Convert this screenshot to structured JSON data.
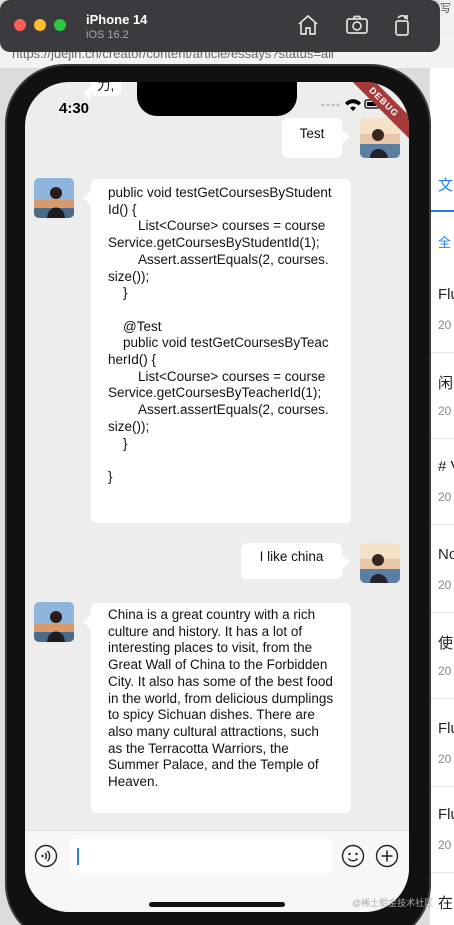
{
  "simulator": {
    "device": "iPhone 14",
    "os": "iOS 16.2",
    "tools": [
      "home-icon",
      "screenshot-icon",
      "rotate-icon"
    ]
  },
  "browser": {
    "url": "https://juejin.cn/creator/content/article/essays?status=all",
    "corner_text": "写",
    "right_items": [
      "文",
      "全",
      "Flu",
      "20",
      "闲",
      "20",
      "# V",
      "20",
      "No",
      "20",
      "使",
      "20",
      "Flu",
      "20",
      "Flu",
      "20",
      "在"
    ],
    "accent": "#1e80ff"
  },
  "status_bar": {
    "time": "4:30",
    "debug_label": "DEBUG"
  },
  "chat": {
    "top_fragment": "力,",
    "messages": [
      {
        "side": "right",
        "text": "Test"
      },
      {
        "side": "left",
        "text": "public void testGetCoursesByStudentId() {\n        List<Course> courses = courseService.getCoursesByStudentId(1);\n        Assert.assertEquals(2, courses.size());\n    }\n\n    @Test\n    public void testGetCoursesByTeacherId() {\n        List<Course> courses = courseService.getCoursesByTeacherId(1);\n        Assert.assertEquals(2, courses.size());\n    }\n\n}"
      },
      {
        "side": "right",
        "text": "I like china"
      },
      {
        "side": "left",
        "text": "China is a great country with a rich culture and history. It has a lot of interesting places to visit, from the Great Wall of China to the Forbidden City. It also has some of the best food in the world, from delicious dumplings to spicy Sichuan dishes. There are also many cultural attractions, such as the Terracotta Warriors, the Summer Palace, and the Temple of Heaven."
      }
    ]
  },
  "input_bar": {
    "value": "",
    "icons": [
      "voice-icon",
      "emoji-icon",
      "add-icon"
    ]
  },
  "watermark": "@稀土掘金技术社区"
}
